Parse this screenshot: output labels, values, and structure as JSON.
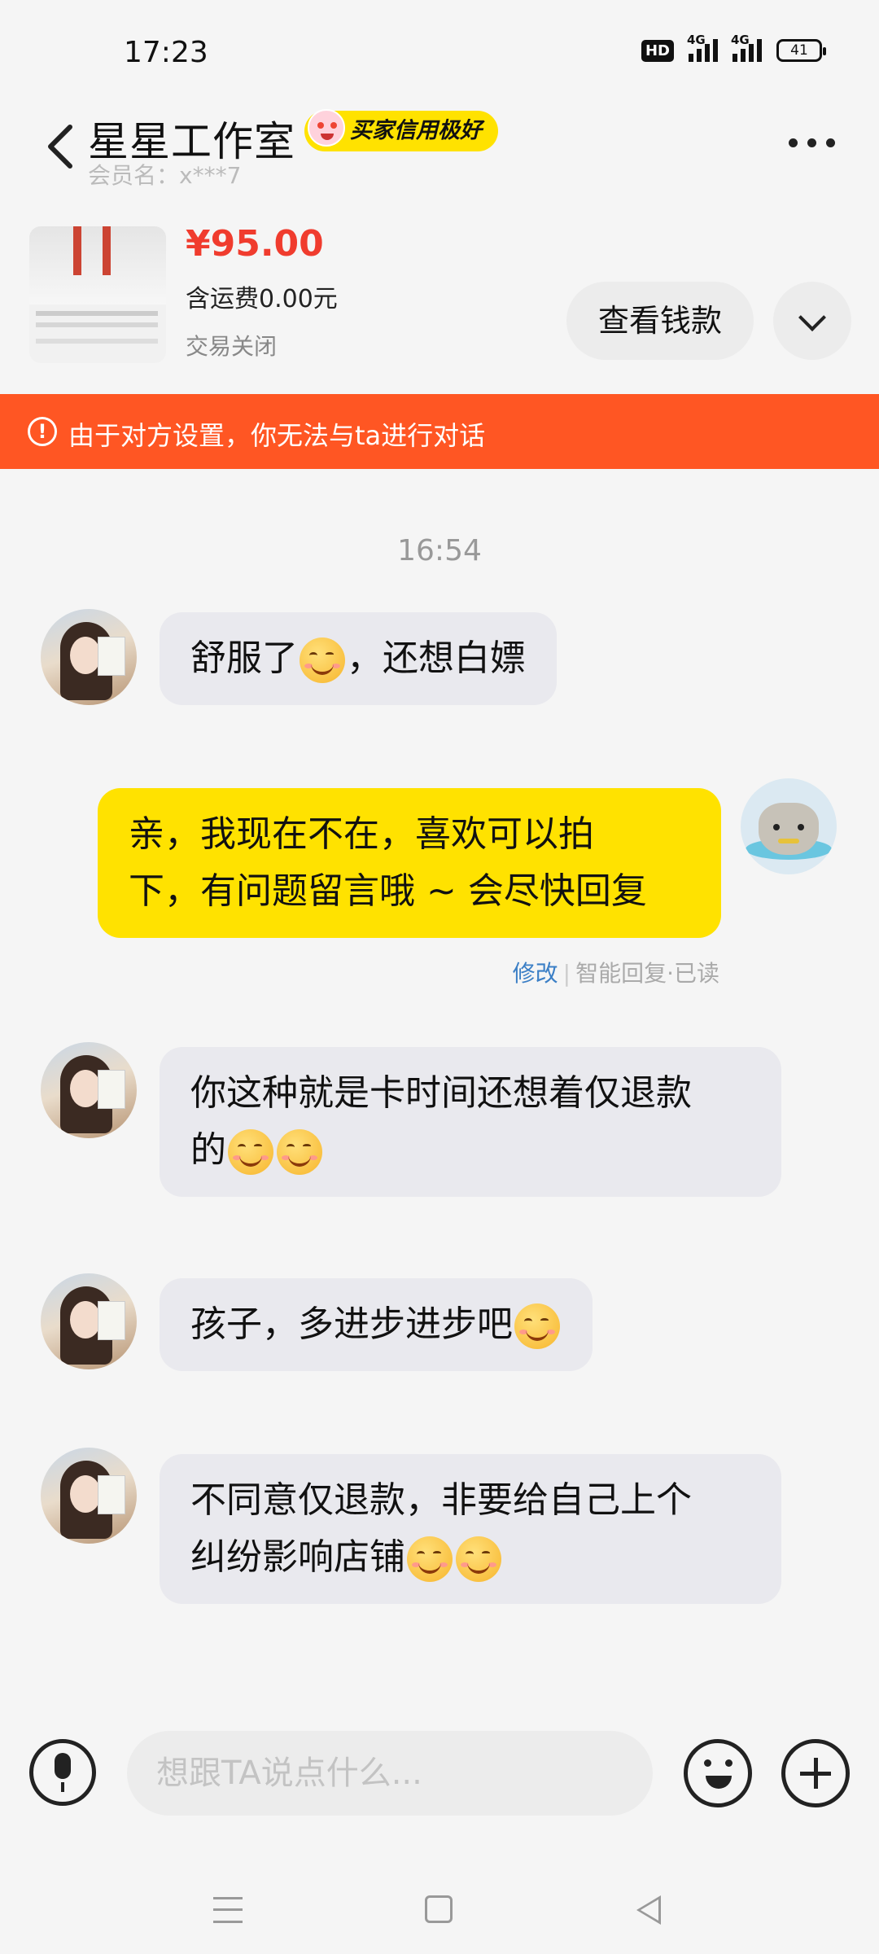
{
  "status_bar": {
    "time": "17:23",
    "hd": "HD",
    "network_1": "4G",
    "network_2": "4G",
    "battery": "41"
  },
  "header": {
    "shop_name": "星星工作室",
    "credit_badge": "买家信用极好",
    "member_name": "会员名：x***7"
  },
  "product": {
    "price": "¥95.00",
    "shipping": "含运费0.00元",
    "status": "交易关闭",
    "view_payment_label": "查看钱款"
  },
  "banner": {
    "text": "由于对方设置，你无法与ta进行对话"
  },
  "chat": {
    "timestamp": "16:54",
    "messages": [
      {
        "side": "other",
        "text_parts": [
          "舒服了",
          "，还想白嫖"
        ]
      },
      {
        "side": "me",
        "lines": [
          "亲，我现在不在，喜欢可以拍",
          "下，有问题留言哦 ~ 会尽快回复"
        ]
      },
      {
        "side": "other",
        "lines": [
          "你这种就是卡时间还想着仅退款",
          "的"
        ]
      },
      {
        "side": "other",
        "text": "孩子，多进步进步吧"
      },
      {
        "side": "other",
        "lines": [
          "不同意仅退款，非要给自己上个",
          "纠纷影响店铺"
        ]
      }
    ],
    "reply_meta": {
      "edit": "修改",
      "info": "智能回复·已读"
    }
  },
  "input": {
    "placeholder": "想跟TA说点什么..."
  },
  "colors": {
    "accent_yellow": "#ffe200",
    "warning_orange": "#ff5623",
    "price_red": "#f03c2e",
    "bubble_gray": "#e9e9ee"
  },
  "icons": [
    "back-icon",
    "more-icon",
    "chevron-down-icon",
    "warning-icon",
    "voice-icon",
    "emoji-icon",
    "plus-icon",
    "nav-menu-icon",
    "nav-home-icon",
    "nav-back-icon"
  ]
}
